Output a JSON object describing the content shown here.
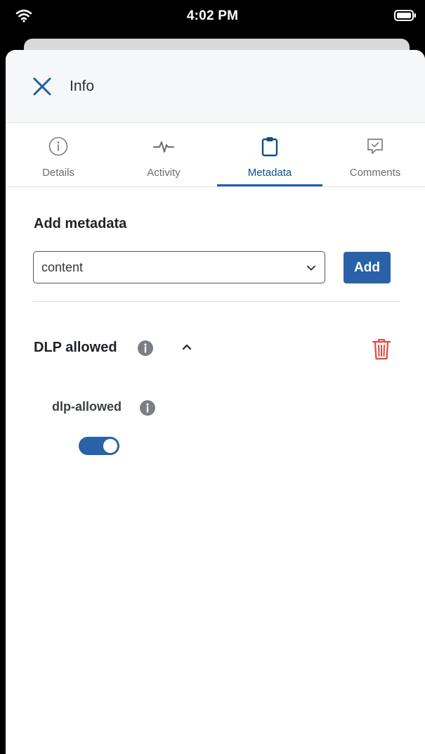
{
  "status_bar": {
    "time": "4:02 PM"
  },
  "header": {
    "title": "Info"
  },
  "tabs": [
    {
      "label": "Details",
      "icon": "info-circle-icon"
    },
    {
      "label": "Activity",
      "icon": "activity-pulse-icon"
    },
    {
      "label": "Metadata",
      "icon": "clipboard-icon"
    },
    {
      "label": "Comments",
      "icon": "comment-check-icon"
    }
  ],
  "active_tab": "Metadata",
  "add_metadata": {
    "title": "Add metadata",
    "select_value": "content",
    "add_label": "Add"
  },
  "group": {
    "title": "DLP allowed",
    "field_label": "dlp-allowed",
    "toggle_on": true
  },
  "colors": {
    "accent": "#2962a8",
    "active_tab_text": "#0a4f8c",
    "delete": "#e0493f",
    "info_icon": "#7b7f85"
  }
}
